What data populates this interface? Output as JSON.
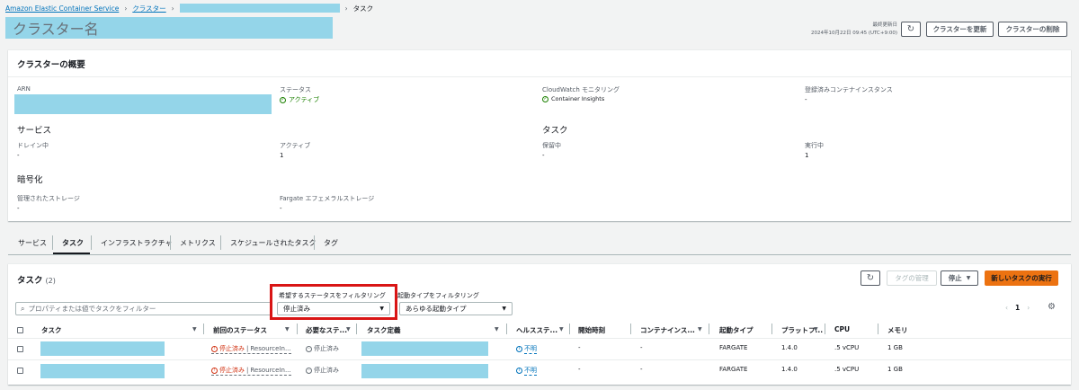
{
  "breadcrumb": {
    "service": "Amazon Elastic Container Service",
    "clusters": "クラスター",
    "current": "タスク"
  },
  "page": {
    "title": "クラスター名",
    "last_updated_label": "最終更新日",
    "last_updated_value": "2024年10月22日 09:45 (UTC+9:00)",
    "update_button": "クラスターを更新",
    "delete_button": "クラスターの削除"
  },
  "overview": {
    "title": "クラスターの概要",
    "arn_label": "ARN",
    "status_label": "ステータス",
    "status_value": "アクティブ",
    "cloudwatch_label": "CloudWatch モニタリング",
    "cloudwatch_value": "Container Insights",
    "instances_label": "登録済みコンテナインスタンス",
    "instances_value": "-",
    "services_heading": "サービス",
    "draining_label": "ドレイン中",
    "draining_value": "-",
    "active_label": "アクティブ",
    "active_value": "1",
    "tasks_heading": "タスク",
    "pending_label": "保留中",
    "pending_value": "-",
    "running_label": "実行中",
    "running_value": "1",
    "encryption_heading": "暗号化",
    "managed_storage_label": "管理されたストレージ",
    "managed_storage_value": "-",
    "fargate_storage_label": "Fargate エフェメラルストレージ",
    "fargate_storage_value": "-"
  },
  "tabs": [
    "サービス",
    "タスク",
    "インフラストラクチャ",
    "メトリクス",
    "スケジュールされたタスク",
    "タグ"
  ],
  "tasks": {
    "title": "タスク",
    "count": "(2)",
    "manage_tags_button": "タグの管理",
    "stop_button": "停止",
    "run_task_button": "新しいタスクの実行",
    "search_placeholder": "プロパティまたは値でタスクをフィルター",
    "status_filter_label": "希望するステータスをフィルタリング",
    "status_filter_value": "停止済み",
    "launch_filter_label": "起動タイプをフィルタリング",
    "launch_filter_value": "あらゆる起動タイプ",
    "page_number": "1",
    "columns": [
      "タスク",
      "前回のステータス",
      "必要なステ...",
      "タスク定義",
      "ヘルスステ...",
      "開始時刻",
      "コンテナインス...",
      "起動タイプ",
      "プラットフ...",
      "CPU",
      "メモリ"
    ],
    "rows": [
      {
        "last_status": "停止済み",
        "reason": "ResourceIn...",
        "desired": "停止済み",
        "health": "不明",
        "started": "-",
        "container": "-",
        "launch": "FARGATE",
        "platform": "1.4.0",
        "cpu": ".5 vCPU",
        "memory": "1 GB"
      },
      {
        "last_status": "停止済み",
        "reason": "ResourceIn...",
        "desired": "停止済み",
        "health": "不明",
        "started": "-",
        "container": "-",
        "launch": "FARGATE",
        "platform": "1.4.0",
        "cpu": ".5 vCPU",
        "memory": "1 GB"
      }
    ]
  },
  "colors": {
    "accent": "#ec7211",
    "link": "#0073bb",
    "highlight": "#d91515",
    "redaction": "#94d5e9",
    "success": "#1d8102",
    "error": "#d13212"
  }
}
